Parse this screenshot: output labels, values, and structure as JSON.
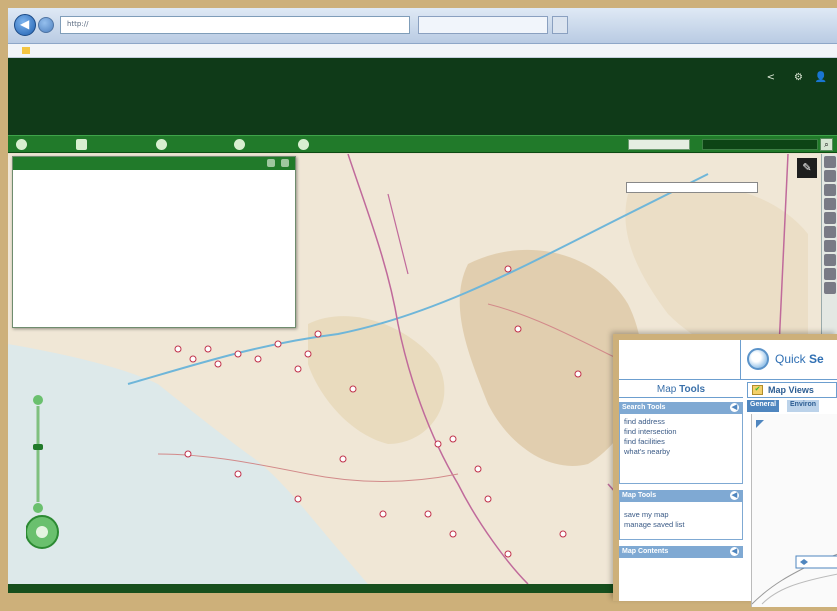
{
  "browser": {
    "address": "http://                                      ",
    "tab_title": "                 ",
    "favorites_item": "           "
  },
  "header": {
    "links": "                                   "
  },
  "toolbar": {
    "items": [
      "        ",
      "          ",
      "          ",
      "        ",
      "           "
    ],
    "basemap_label": "     ",
    "basemap_value": "         ",
    "search_placeholder": "             "
  },
  "tree_panel": {
    "title": "    ",
    "nodes": [
      {
        "level": 1,
        "label": "           "
      },
      {
        "level": 2,
        "label": "                      "
      },
      {
        "level": 3,
        "label": "        "
      },
      {
        "level": 3,
        "label": "        "
      },
      {
        "level": 3,
        "label": "                "
      },
      {
        "level": 3,
        "label": "                "
      }
    ]
  },
  "map": {
    "layer_select": "                    "
  },
  "status_bar": {
    "text": "                                                                            "
  },
  "overlay": {
    "quick_search_plain": "Quick ",
    "quick_search_bold": "Se",
    "map_tools_plain": "Map ",
    "map_tools_bold": "Tools",
    "map_views_label": "Map Views",
    "search_tools_header": "Search Tools",
    "search_tools": [
      "find address",
      "find intersection",
      "find facilities",
      "what's nearby"
    ],
    "map_tools_header": "Map Tools",
    "map_tools": [
      "save my map",
      "manage saved list"
    ],
    "map_contents_header": "Map Contents",
    "tabs": [
      "General",
      "Environ"
    ]
  }
}
